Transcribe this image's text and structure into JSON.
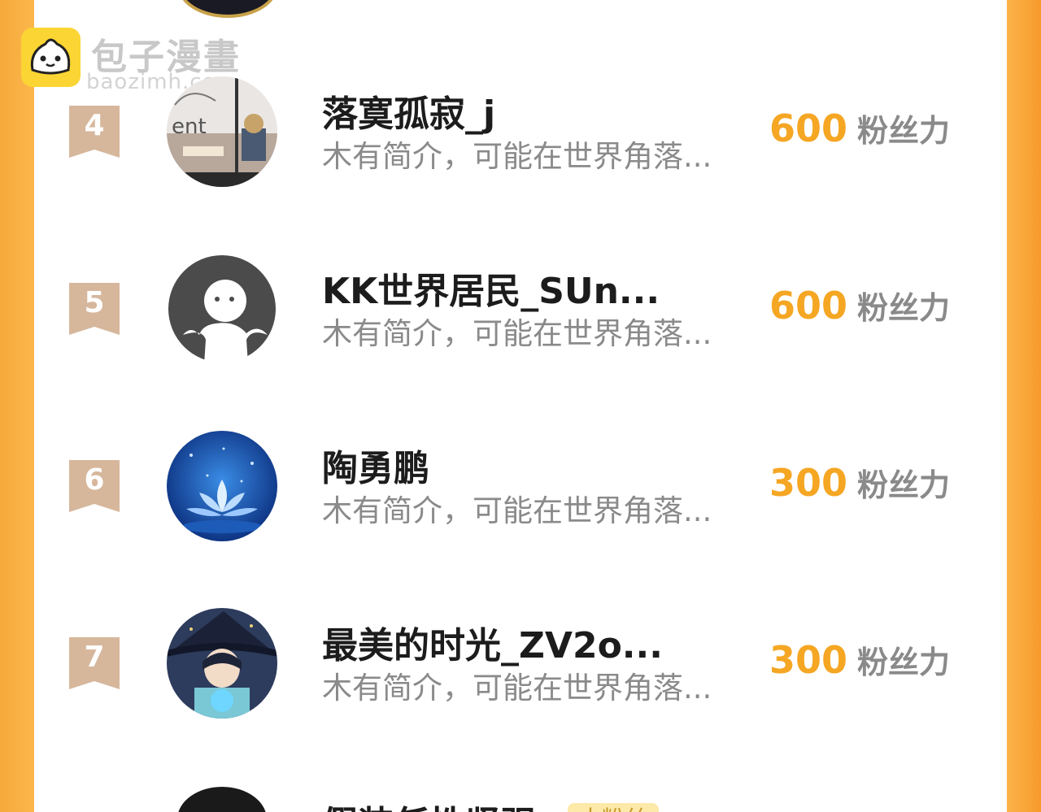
{
  "watermark": {
    "title": "包子漫畫",
    "subtitle": "baozimh.com"
  },
  "rows": [
    {
      "rank": "4",
      "name": "落寞孤寂_j",
      "desc": "木有简介，可能在世界角落...",
      "score": "600",
      "unit": "粉丝力",
      "avatar": "avatar-scenery"
    },
    {
      "rank": "5",
      "name": "KK世界居民_SUn...",
      "desc": "木有简介，可能在世界角落...",
      "score": "600",
      "unit": "粉丝力",
      "avatar": "avatar-default"
    },
    {
      "rank": "6",
      "name": "陶勇鹏",
      "desc": "木有简介，可能在世界角落...",
      "score": "300",
      "unit": "粉丝力",
      "avatar": "avatar-lotus"
    },
    {
      "rank": "7",
      "name": "最美的时光_ZV2o...",
      "desc": "木有简介，可能在世界角落...",
      "score": "300",
      "unit": "粉丝力",
      "avatar": "avatar-anime"
    }
  ],
  "last_row": {
    "name": "假装任性坚强",
    "tag": "大粉丝"
  },
  "colors": {
    "frame": "#f7a93a",
    "score": "#f5a623",
    "badge": "#d6b79c"
  }
}
